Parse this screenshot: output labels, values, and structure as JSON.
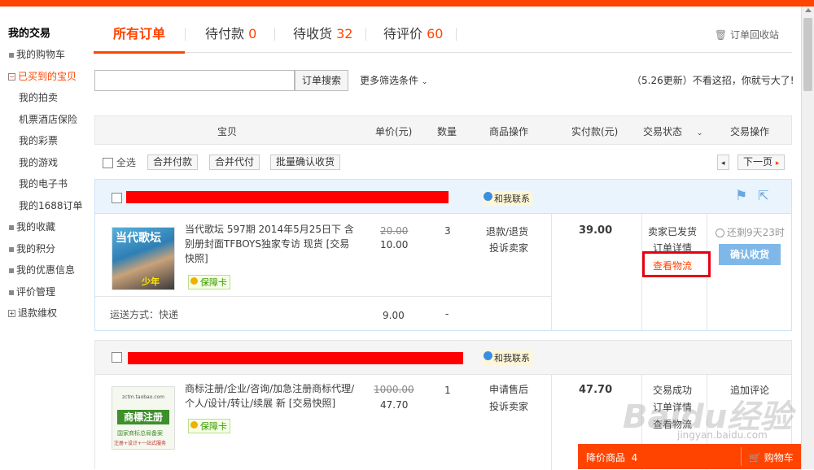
{
  "sidebar": {
    "title": "我的交易",
    "items": [
      {
        "label": "我的购物车",
        "kind": "bullet"
      },
      {
        "label": "已买到的宝贝",
        "kind": "box-minus",
        "active": true
      },
      {
        "label": "我的拍卖",
        "kind": "sub"
      },
      {
        "label": "机票酒店保险",
        "kind": "sub"
      },
      {
        "label": "我的彩票",
        "kind": "sub"
      },
      {
        "label": "我的游戏",
        "kind": "sub"
      },
      {
        "label": "我的电子书",
        "kind": "sub"
      },
      {
        "label": "我的1688订单",
        "kind": "sub"
      },
      {
        "label": "我的收藏",
        "kind": "bullet"
      },
      {
        "label": "我的积分",
        "kind": "bullet"
      },
      {
        "label": "我的优惠信息",
        "kind": "bullet"
      },
      {
        "label": "评价管理",
        "kind": "bullet"
      },
      {
        "label": "退款维权",
        "kind": "box-plus"
      }
    ]
  },
  "tabs": [
    {
      "label": "所有订单",
      "count": ""
    },
    {
      "label": "待付款",
      "count": "0"
    },
    {
      "label": "待收货",
      "count": "32"
    },
    {
      "label": "待评价",
      "count": "60"
    }
  ],
  "recycle_bin": "订单回收站",
  "search": {
    "value": "",
    "button": "订单搜索",
    "more_filters": "更多筛选条件"
  },
  "promo_text": "（5.26更新）不看这招，你就亏大了!",
  "table_headers": [
    "宝贝",
    "单价(元)",
    "数量",
    "商品操作",
    "实付款(元)",
    "交易状态",
    "交易操作"
  ],
  "toolbar": {
    "select_all": "全选",
    "merge_pay": "合并付款",
    "merge_proxy": "合并代付",
    "batch_confirm": "批量确认收货",
    "next_page": "下一页"
  },
  "contact_label": "和我联系",
  "orders": [
    {
      "title": "当代歌坛 597期 2014年5月25日下 含别册封面TFBOYS独家专访 现货 [交易快照]",
      "badge": "保障卡",
      "original_price": "20.00",
      "price": "10.00",
      "quantity": "3",
      "item_ops": [
        "退款/退货",
        "投诉卖家"
      ],
      "paid": "39.00",
      "status": [
        "卖家已发货",
        "订单详情",
        "查看物流"
      ],
      "countdown": "还剩9天23时",
      "action": "确认收货",
      "shipping_label": "运送方式：快递",
      "shipping_fee": "9.00",
      "shipping_dash": "-"
    },
    {
      "title": "商标注册/企业/咨询/加急注册商标代理/个人/设计/转让/续展 新 [交易快照]",
      "badge": "保障卡",
      "original_price": "1000.00",
      "price": "47.70",
      "quantity": "1",
      "item_ops": [
        "申请售后",
        "投诉卖家"
      ],
      "paid": "47.70",
      "status": [
        "交易成功",
        "订单详情",
        "查看物流"
      ],
      "action": "追加评论",
      "thumb_text": "商標注册",
      "thumb_url": "zctm.taobao.com",
      "thumb_sub1": "国家商标总局备案",
      "thumb_sub2": "注册+设计+一站式服务"
    }
  ],
  "thumb1_text": [
    "当代歌坛",
    "少年"
  ],
  "bottom_bar": {
    "label": "降价商品",
    "count": "4",
    "cart": "购物车"
  },
  "watermark": "Baidu经验",
  "watermark_url": "jingyan.baidu.com"
}
